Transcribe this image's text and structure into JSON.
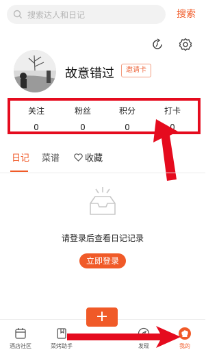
{
  "search": {
    "placeholder": "搜索达人和日记",
    "button_label": "搜索"
  },
  "profile": {
    "username": "故意错过",
    "invite_label": "邀请卡"
  },
  "stats": [
    {
      "label": "关注",
      "value": "0"
    },
    {
      "label": "粉丝",
      "value": "0"
    },
    {
      "label": "积分",
      "value": "0"
    },
    {
      "label": "打卡",
      "value": "0"
    }
  ],
  "tabs": [
    {
      "label": "日记"
    },
    {
      "label": "菜谱"
    },
    {
      "label": "收藏"
    }
  ],
  "empty_state": {
    "message": "请登录后查看日记记录",
    "login_label": "立即登录"
  },
  "bottom_nav": [
    {
      "label": "酒店社区"
    },
    {
      "label": "菜烤助手"
    },
    {
      "label": ""
    },
    {
      "label": "发现"
    },
    {
      "label": "我的"
    }
  ],
  "colors": {
    "accent": "#f05a28",
    "highlight": "#e50b1e"
  }
}
